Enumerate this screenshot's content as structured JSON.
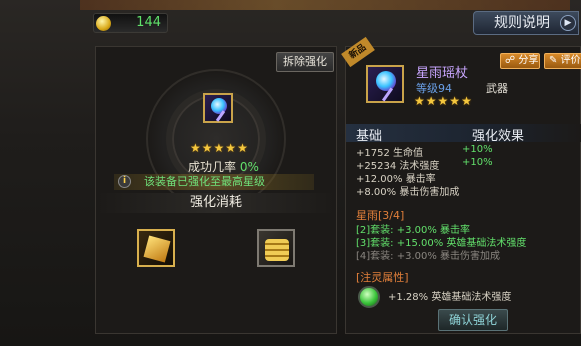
{
  "header": {
    "currency_value": "144",
    "rules_label": "规则说明",
    "rules_arrow": "▶"
  },
  "enhance": {
    "remove_label": "拆除强化",
    "stars": [
      "★",
      "★",
      "★",
      "★",
      "★"
    ],
    "success_label": "成功几率",
    "success_value": "0%",
    "notice_icon": "i",
    "notice_text": "该装备已强化至最高星级",
    "consume_title": "强化消耗"
  },
  "item": {
    "new_tag": "新品",
    "name": "星雨瑶杖",
    "level": "等级94",
    "type": "武器",
    "stars": [
      "★",
      "★",
      "★",
      "★",
      "★"
    ],
    "share_label": "分享",
    "rate_label": "评价",
    "stats_header": "基础",
    "bonus_header": "强化效果",
    "stats": [
      {
        "text": "+1752 生命值",
        "bonus": "+10%"
      },
      {
        "text": "+25234 法术强度",
        "bonus": "+10%"
      },
      {
        "text": "+12.00% 暴击率",
        "bonus": ""
      },
      {
        "text": "+8.00% 暴击伤害加成",
        "bonus": ""
      }
    ],
    "set_title": "星雨[3/4]",
    "set_bonuses": [
      {
        "text": "[2]套装: +3.00% 暴击率",
        "active": true
      },
      {
        "text": "[3]套装: +15.00% 英雄基础法术强度",
        "active": true
      },
      {
        "text": "[4]套装: +3.00% 暴击伤害加成",
        "active": false
      }
    ],
    "inject_title": "[注灵属性]",
    "inject_text": "+1.28% 英雄基础法术强度",
    "confirm_label": "确认强化"
  },
  "colors": {
    "green": "#62e06b",
    "orange": "#e07f3a",
    "gold": "#f4c73e",
    "purple": "#c9a6ff"
  },
  "icons": [
    "coin-icon",
    "arrow-right-icon",
    "info-icon",
    "share-icon",
    "edit-icon",
    "staff-icon",
    "gold-box-icon",
    "gold-coins-icon",
    "green-orb-icon"
  ]
}
